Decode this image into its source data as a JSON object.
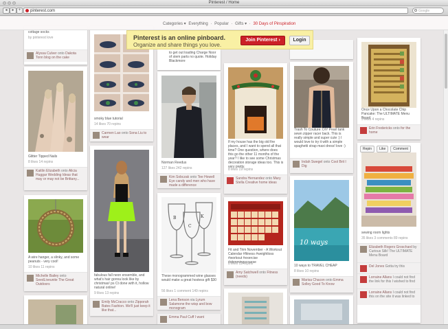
{
  "window": {
    "title": "Pinterest / Home"
  },
  "browser": {
    "url": "pinterest.com",
    "search_placeholder": "Google"
  },
  "menu": {
    "categories": "Categories ▾",
    "everything": "Everything",
    "sep1": "·",
    "popular": "Popular",
    "sep2": "·",
    "gifts": "Gifts ▾",
    "sep3": "·",
    "special": "30 Days of Pinspiration"
  },
  "banner": {
    "line1": "Pinterest is an online pinboard.",
    "line2": "Organize and share things you love.",
    "join": "Join Pinterest ›",
    "login": "Login"
  },
  "pins": {
    "p1": {
      "desc": "cottage socks",
      "stats": "by pinterest love",
      "attr_user": "Alyssa Culver",
      "attr_onto": "onto",
      "attr_user2": "Dakota Tonn",
      "attr_board": "blog on the cake"
    },
    "p2": {
      "desc": "Glitter Tipped Nails",
      "stats": "8 likes    14 repins",
      "attr_user": "Kaitlin Elizabeth",
      "attr_onto": "onto",
      "attr_user2": "Alicia Huggar",
      "attr_board": "Wedding Ideas that may or may not be Brittany..."
    },
    "p3": {
      "desc": "A wire hanger, a slinky, and some peanuts - very cool!",
      "stats": "10 likes   11 repins",
      "attr_user": "Michelle Bailey",
      "attr_onto": "onto",
      "attr_user2": "SeedLiveunite",
      "attr_board": "The Great Outdoors"
    },
    "p4": {
      "desc": "smoky blue tutorial",
      "stats": "14 likes   70 repins",
      "attr_user": "Carmen Lao",
      "attr_onto": "onto",
      "attr_user2": "Sona Liu",
      "attr_board": "to wear"
    },
    "p5": {
      "desc": "fabulous fall neon ensemble, and what's hair gonna look like by christmas! ps Ct done with it, hollow natural online!",
      "stats": "9 likes   13 repins",
      "attr_user": "Emily McCracco",
      "attr_onto": "onto",
      "attr_user2": "Zipporah Bates",
      "attr_board": "Fashion. We'll just keep it like that..."
    },
    "p6": {
      "desc": "to get out loading Charge Noor of stem parts no quote. Holiday Blackmore",
      "stats": "",
      "attr_user": "",
      "attr_onto": "",
      "attr_user2": "",
      "attr_board": ""
    },
    "p7": {
      "desc": "Norman Reedus",
      "stats": "127 likes   242 repins",
      "attr_user": "Kim Sobczak",
      "attr_onto": "onto",
      "attr_user2": "Tee Howell",
      "attr_board": "Eye candy and men who have made a difference"
    },
    "p8": {
      "desc": "These monogrammed wine glasses would make a great hostess gift $30",
      "stats": "56 likes   1 comment   149 repins",
      "attr_user": "Lena Benson",
      "attr_onto": "via",
      "attr_user2": "Lyrum Salamone",
      "attr_board": "the wisp and bow monogram"
    },
    "p9": {
      "desc": "",
      "stats": "",
      "attr_user": "Emma Paul Cuff",
      "attr_onto": "",
      "attr_user2": "",
      "attr_board": "I want"
    },
    "p10": {
      "desc": "If my house has the big old fire places, and I want to spend all that time? One question, where does this go the other 11 months of the year? I like to see some Christmas decoration storage ideas too. This is very pretty.",
      "stats": "8 likes   19 repins",
      "attr_user": "Sandra Hernandez",
      "attr_onto": "onto",
      "attr_user2": "Mary Stella",
      "attr_board": "Creative home ideas"
    },
    "p11": {
      "desc": "Fit and Trim November - A Workout Calendar #fitness #weightloss #workout #exercise #ohmmingscoarse",
      "stats": "8 likes   12 repins",
      "attr_user": "Amy Satchwell",
      "attr_onto": "onto",
      "attr_user2": "Fitness (needs)",
      "attr_board": ""
    },
    "p12": {
      "desc": "Trash To Couture: DIY Pearl tank sewn zipper racer back. This is really simple and super cute :) I would love to try it with a simple spaghetti strap maxi dress! love :)",
      "stats": "",
      "attr_user": "Indah Swegel",
      "attr_onto": "onto",
      "attr_user2": "Cool Brit",
      "attr_board": "I Dig"
    },
    "p13": {
      "desc": "10 ways to TRAVEL CHEAP",
      "stats": "8 likes   10 repins",
      "attr_user": "Marisa Chacon",
      "attr_onto": "onto",
      "attr_user2": "Emma Solley",
      "attr_board": "Good To Know"
    },
    "p14": {
      "desc": "Once Upon a Chocolate Chip Pancake: The ULTIMATE Menu Board",
      "stats": "3 likes   4 repins",
      "attr_user": "Erin Fredericks",
      "attr_onto": "onto",
      "attr_user2": "",
      "attr_board": "for the home"
    },
    "p15": {
      "desc": "sewing room lights",
      "stats": "35 likes   3 comments   89 repins",
      "hover_repin": "Repin",
      "hover_like": "Like",
      "hover_comment": "Comment",
      "c1_user": "Elizabeth Rogers Groschard",
      "c1_text": "by Curious Silk! The ULTIMATE Menu Board",
      "c2_user": "Del Jones",
      "c2_text": "Gotta try this",
      "c3_user": "Lorraine Allans",
      "c3_text": "I could not find the link for this I wished to find",
      "c4_user": "Lorraine Allans",
      "c4_text": "I could not find this on the site it was linked to"
    }
  }
}
